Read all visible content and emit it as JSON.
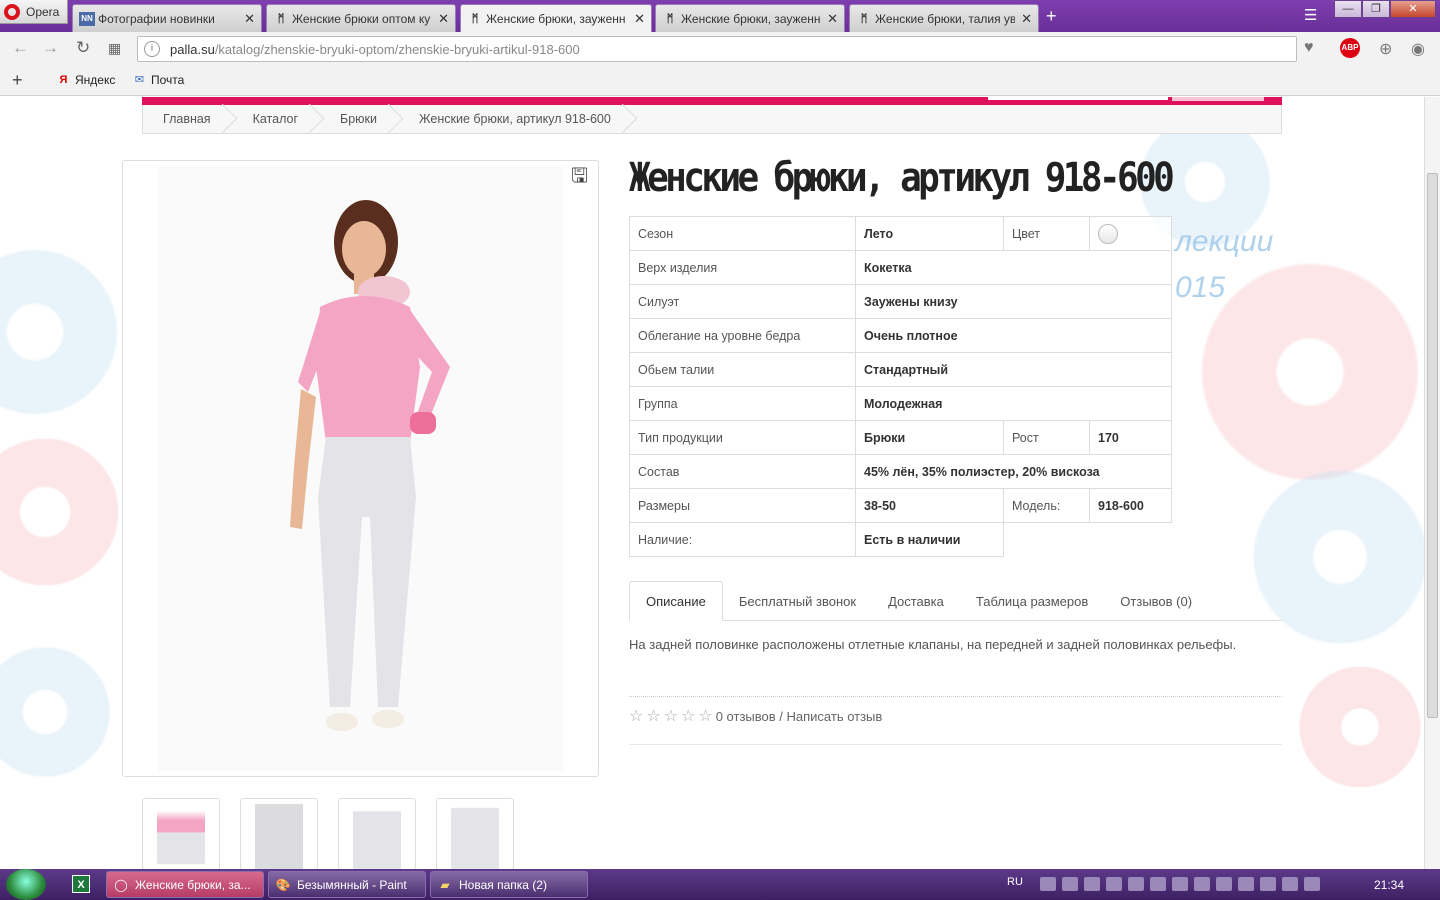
{
  "browser": {
    "menu_label": "Opera",
    "tabs": [
      {
        "title": "Фотографии новинки",
        "icon": "NN"
      },
      {
        "title": "Женские брюки оптом ку",
        "icon": "palla"
      },
      {
        "title": "Женские брюки, зауженн",
        "icon": "palla"
      },
      {
        "title": "Женские брюки, зауженн",
        "icon": "palla"
      },
      {
        "title": "Женские брюки, талия ув",
        "icon": "palla"
      }
    ],
    "url_domain": "palla.su",
    "url_path": "/katalog/zhenskie-bryuki-optom/zhenskie-bryuki-artikul-918-600",
    "bookmarks": [
      "Яндекс",
      "Почта"
    ],
    "adblock_label": "ABP"
  },
  "breadcrumb": [
    "Главная",
    "Каталог",
    "Брюки",
    "Женские брюки, артикул 918-600"
  ],
  "product": {
    "title": "Женские брюки, артикул 918-600",
    "specs": {
      "season_label": "Сезон",
      "season_value": "Лето",
      "color_label": "Цвет",
      "top_label": "Верх изделия",
      "top_value": "Кокетка",
      "silhouette_label": "Силуэт",
      "silhouette_value": "Заужены книзу",
      "fit_label": "Облегание на уровне бедра",
      "fit_value": "Очень плотное",
      "waist_label": "Обьем талии",
      "waist_value": "Стандартный",
      "group_label": "Группа",
      "group_value": "Молодежная",
      "type_label": "Тип продукции",
      "type_value": "Брюки",
      "height_label": "Рост",
      "height_value": "170",
      "composition_label": "Состав",
      "composition_value": "45% лён, 35% полиэстер, 20% вискоза",
      "sizes_label": "Размеры",
      "sizes_value": "38-50",
      "model_label": "Модель:",
      "model_value": "918-600",
      "availability_label": "Наличие:",
      "availability_value": "Есть в наличии"
    },
    "tabs": [
      "Описание",
      "Бесплатный звонок",
      "Доставка",
      "Таблица размеров",
      "Отзывов (0)"
    ],
    "description": "На задней половинке расположены отлетные клапаны, на передней и задней половинках рельефы.",
    "reviews_text": "0 отзывов / Написать отзыв",
    "rating_stars": 0,
    "rating_max": 5
  },
  "decor_text": [
    "лекции",
    "015"
  ],
  "taskbar": {
    "items": [
      "Женские брюки, за...",
      "Безымянный - Paint",
      "Новая папка (2)"
    ],
    "language": "RU",
    "clock": "21:34"
  },
  "colors": {
    "accent": "#e0115c",
    "chrome": "#7e3fae",
    "taskbar": "#5d3a8a"
  }
}
